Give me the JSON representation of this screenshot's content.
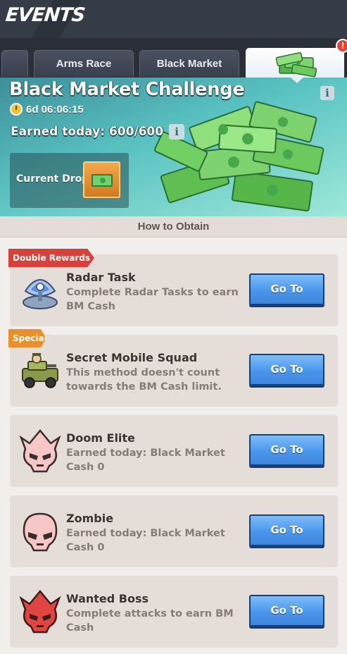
{
  "header": {
    "title": "EVENTS"
  },
  "tabs": {
    "arms_race": "Arms Race",
    "black_market": "Black Market",
    "alert_badge": "!"
  },
  "banner": {
    "title": "Black Market Challenge",
    "timer": "6d 06:06:15",
    "earned_today": "Earned today: 600/600",
    "current_drop_label": "Current Drop:",
    "info_glyph": "i"
  },
  "how_to_obtain": "How to Obtain",
  "ribbons": {
    "double": "Double Rewards",
    "special": "Special"
  },
  "tasks": [
    {
      "title": "Radar Task",
      "desc": "Complete Radar Tasks to earn BM Cash",
      "button": "Go To",
      "icon": "radar-icon"
    },
    {
      "title": "Secret Mobile Squad",
      "desc": "This method doesn't count towards the BM Cash limit.",
      "button": "Go To",
      "icon": "jeep-icon"
    },
    {
      "title": "Doom Elite",
      "desc": "Earned today: Black Market Cash 0",
      "button": "Go To",
      "icon": "doom-elite-skull-icon"
    },
    {
      "title": "Zombie",
      "desc": "Earned today: Black Market Cash 0",
      "button": "Go To",
      "icon": "zombie-skull-icon"
    },
    {
      "title": "Wanted Boss",
      "desc": "Complete attacks to earn BM Cash",
      "button": "Go To",
      "icon": "wanted-boss-skull-icon"
    }
  ],
  "colors": {
    "go_button": "#4a96ec",
    "double_ribbon": "#d8403a",
    "special_ribbon": "#e9902a",
    "banner": "#5ac3c2"
  }
}
